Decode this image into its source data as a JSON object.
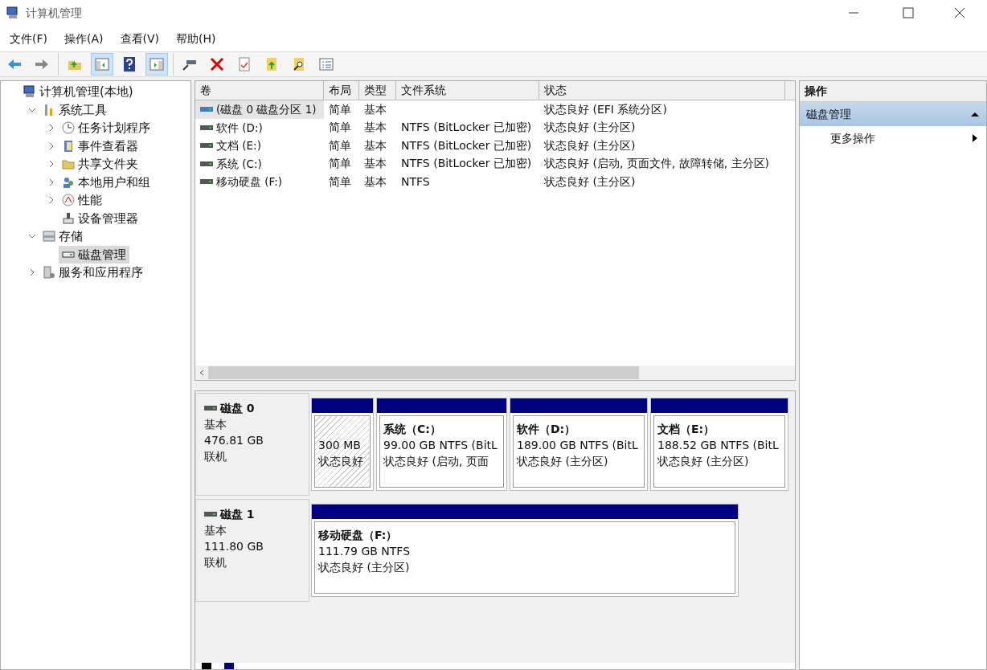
{
  "window": {
    "title": "计算机管理"
  },
  "menu": [
    "文件(F)",
    "操作(A)",
    "查看(V)",
    "帮助(H)"
  ],
  "toolbar": [
    [
      {
        "kind": "back",
        "pressed": false
      },
      {
        "kind": "forward",
        "pressed": false
      }
    ],
    [
      {
        "kind": "up",
        "pressed": false
      },
      {
        "kind": "tree",
        "pressed": true
      },
      {
        "kind": "help",
        "pressed": false
      },
      {
        "kind": "action",
        "pressed": true
      }
    ],
    [
      {
        "kind": "connect",
        "pressed": false
      },
      {
        "kind": "delete",
        "pressed": false
      },
      {
        "kind": "properties",
        "pressed": false
      },
      {
        "kind": "export",
        "pressed": false
      },
      {
        "kind": "find",
        "pressed": false
      },
      {
        "kind": "list",
        "pressed": false
      }
    ]
  ],
  "tree": [
    {
      "label": "计算机管理(本地)",
      "selected": false,
      "children": [
        {
          "label": "系统工具",
          "expanded": true,
          "selected": false,
          "children": [
            {
              "label": "任务计划程序",
              "expanded": false,
              "selected": false
            },
            {
              "label": "事件查看器",
              "expanded": false,
              "selected": false
            },
            {
              "label": "共享文件夹",
              "expanded": false,
              "selected": false
            },
            {
              "label": "本地用户和组",
              "expanded": false,
              "selected": false
            },
            {
              "label": "性能",
              "expanded": false,
              "selected": false
            },
            {
              "label": "设备管理器",
              "selected": false
            }
          ]
        },
        {
          "label": "存储",
          "expanded": true,
          "selected": false,
          "children": [
            {
              "label": "磁盘管理",
              "selected": true
            }
          ]
        },
        {
          "label": "服务和应用程序",
          "expanded": false,
          "selected": false
        }
      ]
    }
  ],
  "table": {
    "columns": [
      "卷",
      "布局",
      "类型",
      "文件系统",
      "状态"
    ],
    "rows": [
      {
        "selected": true,
        "cells": [
          "(磁盘 0 磁盘分区 1)",
          "简单",
          "基本",
          "",
          "状态良好 (EFI 系统分区)"
        ]
      },
      {
        "selected": false,
        "cells": [
          "软件 (D:)",
          "简单",
          "基本",
          "NTFS (BitLocker 已加密)",
          "状态良好 (主分区)"
        ]
      },
      {
        "selected": false,
        "cells": [
          "文档 (E:)",
          "简单",
          "基本",
          "NTFS (BitLocker 已加密)",
          "状态良好 (主分区)"
        ]
      },
      {
        "selected": false,
        "cells": [
          "系统 (C:)",
          "简单",
          "基本",
          "NTFS (BitLocker 已加密)",
          "状态良好 (启动, 页面文件, 故障转储, 主分区)"
        ]
      },
      {
        "selected": false,
        "cells": [
          "移动硬盘 (F:)",
          "简单",
          "基本",
          "NTFS",
          "状态良好 (主分区)"
        ]
      }
    ]
  },
  "disks": [
    {
      "name": "磁盘 0",
      "type": "基本",
      "size": "476.81 GB",
      "status": "联机",
      "partitions": [
        {
          "size": "300 MB",
          "status": "状态良好",
          "selected": true
        },
        {
          "name": "系统（C:）",
          "size": "99.00 GB NTFS (BitL",
          "status": "状态良好 (启动, 页面",
          "selected": false
        },
        {
          "name": "软件（D:）",
          "size": "189.00 GB NTFS (BitL",
          "status": "状态良好 (主分区)",
          "selected": false
        },
        {
          "name": "文档（E:）",
          "size": "188.52 GB NTFS (BitL",
          "status": "状态良好 (主分区)",
          "selected": false
        }
      ]
    },
    {
      "name": "磁盘 1",
      "type": "基本",
      "size": "111.80 GB",
      "status": "联机",
      "partitions": [
        {
          "name": "移动硬盘（F:）",
          "size": "111.79 GB NTFS",
          "status": "状态良好 (主分区)",
          "selected": false
        }
      ]
    }
  ],
  "legend": [
    {
      "color": "#000000"
    },
    {
      "color": "#000080"
    }
  ],
  "actions": {
    "title": "操作",
    "section": {
      "label": "磁盘管理",
      "expanded": true
    },
    "items": [
      "更多操作"
    ]
  }
}
